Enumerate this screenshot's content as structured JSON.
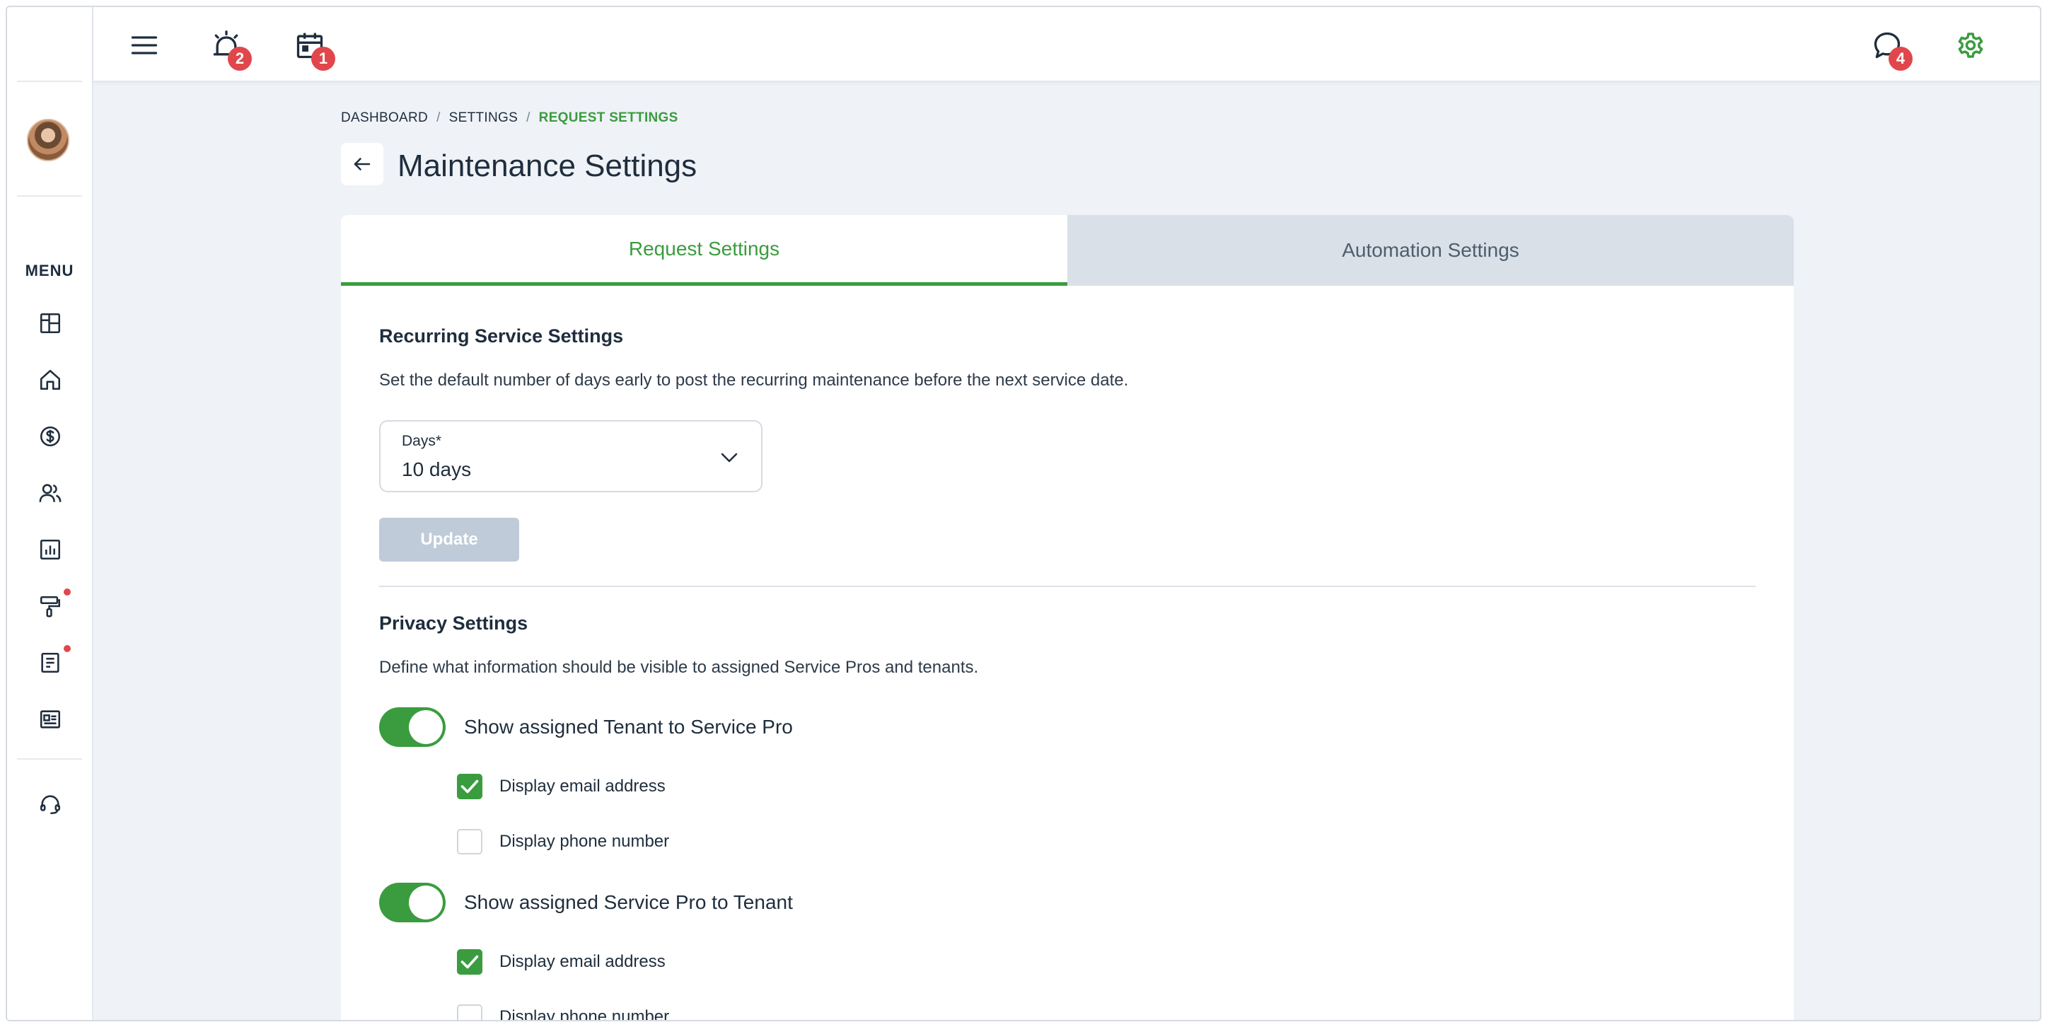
{
  "sidebar": {
    "menu_label": "MENU",
    "items": [
      {
        "icon": "dashboard-icon"
      },
      {
        "icon": "home-icon"
      },
      {
        "icon": "dollar-icon"
      },
      {
        "icon": "people-icon"
      },
      {
        "icon": "reports-icon"
      },
      {
        "icon": "maintenance-icon"
      },
      {
        "icon": "document-icon"
      },
      {
        "icon": "listing-icon"
      }
    ],
    "support_icon": "headset-icon"
  },
  "topbar": {
    "alarm_badge": "2",
    "calendar_badge": "1",
    "chat_badge": "4"
  },
  "breadcrumb": {
    "items": [
      "DASHBOARD",
      "SETTINGS"
    ],
    "current": "REQUEST SETTINGS"
  },
  "page": {
    "title": "Maintenance Settings"
  },
  "tabs": [
    {
      "label": "Request Settings",
      "active": true
    },
    {
      "label": "Automation Settings",
      "active": false
    }
  ],
  "recurring": {
    "title": "Recurring Service Settings",
    "description": "Set the default number of days early to post the recurring maintenance before the next service date.",
    "days_label": "Days*",
    "days_value": "10 days",
    "update_label": "Update"
  },
  "privacy": {
    "title": "Privacy Settings",
    "description": "Define what information should be visible to assigned Service Pros and tenants.",
    "groups": [
      {
        "toggle_label": "Show assigned Tenant to Service Pro",
        "enabled": true,
        "options": [
          {
            "label": "Display email address",
            "checked": true
          },
          {
            "label": "Display phone number",
            "checked": false
          }
        ]
      },
      {
        "toggle_label": "Show assigned Service Pro to Tenant",
        "enabled": true,
        "options": [
          {
            "label": "Display email address",
            "checked": true
          },
          {
            "label": "Display phone number",
            "checked": false
          }
        ]
      }
    ]
  },
  "colors": {
    "accent": "#3a9c3f",
    "badge": "#e0474c",
    "background": "#eff2f7",
    "inactive_tab": "#d9e0e8"
  }
}
